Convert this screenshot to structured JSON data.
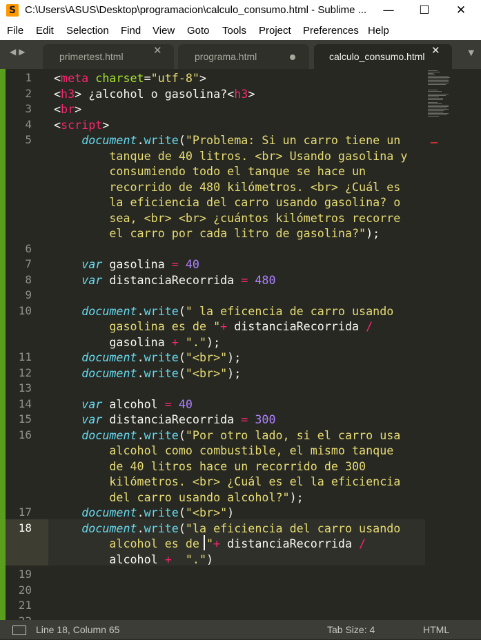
{
  "window": {
    "title": "C:\\Users\\ASUS\\Desktop\\programacion\\calculo_consumo.html - Sublime ...",
    "app_icon_glyph": "S",
    "minimize_glyph": "—",
    "maximize_glyph": "☐",
    "close_glyph": "✕"
  },
  "menu": [
    "File",
    "Edit",
    "Selection",
    "Find",
    "View",
    "Goto",
    "Tools",
    "Project",
    "Preferences",
    "Help"
  ],
  "tabs": [
    {
      "label": "primertest.html",
      "state": "close"
    },
    {
      "label": "programa.html",
      "state": "modified"
    },
    {
      "label": "calculo_consumo.html",
      "state": "close",
      "active": true
    }
  ],
  "tab_close_glyph": "✕",
  "nav_arrows": "◀▶",
  "overflow_glyph": "▼",
  "editor": {
    "line_numbers": [
      "1",
      "2",
      "3",
      "4",
      "5",
      "6",
      "7",
      "8",
      "9",
      "10",
      "11",
      "12",
      "13",
      "14",
      "15",
      "16",
      "17",
      "18",
      "19",
      "20",
      "21",
      "22"
    ],
    "current_line": "18",
    "code": [
      [
        {
          "t": "<"
        },
        {
          "c": "tag",
          "t": "meta"
        },
        {
          "t": " "
        },
        {
          "c": "attr",
          "t": "charset"
        },
        {
          "t": "="
        },
        {
          "c": "str",
          "t": "\"utf-8\""
        },
        {
          "t": ">"
        }
      ],
      [
        {
          "t": "<"
        },
        {
          "c": "tag",
          "t": "h3"
        },
        {
          "t": "> ¿alcohol o gasolina?<"
        },
        {
          "c": "tag",
          "t": "h3"
        },
        {
          "t": ">"
        }
      ],
      [
        {
          "t": "<"
        },
        {
          "c": "tag",
          "t": "br"
        },
        {
          "t": ">"
        }
      ],
      [
        {
          "t": "<"
        },
        {
          "c": "tag",
          "t": "script"
        },
        {
          "t": ">"
        }
      ],
      [
        {
          "t": "    "
        },
        {
          "c": "obj",
          "t": "document"
        },
        {
          "t": "."
        },
        {
          "c": "fn",
          "t": "write"
        },
        {
          "t": "("
        },
        {
          "c": "str",
          "t": "\"Problema: Si un carro tiene un"
        }
      ],
      [
        {
          "c": "str",
          "t": "        tanque de 40 litros. <br> Usando gasolina y"
        }
      ],
      [
        {
          "c": "str",
          "t": "        consumiendo todo el tanque se hace un"
        }
      ],
      [
        {
          "c": "str",
          "t": "        recorrido de 480 kilómetros. <br> ¿Cuál es"
        }
      ],
      [
        {
          "c": "str",
          "t": "        la eficiencia del carro usando gasolina? o"
        }
      ],
      [
        {
          "c": "str",
          "t": "        sea, <br> <br> ¿cuántos kilómetros recorre"
        }
      ],
      [
        {
          "c": "str",
          "t": "        el carro por cada litro de gasolina?\""
        },
        {
          "t": ");"
        }
      ],
      [],
      [
        {
          "t": "    "
        },
        {
          "c": "kw",
          "t": "var"
        },
        {
          "t": " gasolina "
        },
        {
          "c": "op",
          "t": "="
        },
        {
          "t": " "
        },
        {
          "c": "num",
          "t": "40"
        }
      ],
      [
        {
          "t": "    "
        },
        {
          "c": "kw",
          "t": "var"
        },
        {
          "t": " distanciaRecorrida "
        },
        {
          "c": "op",
          "t": "="
        },
        {
          "t": " "
        },
        {
          "c": "num",
          "t": "480"
        }
      ],
      [],
      [
        {
          "t": "    "
        },
        {
          "c": "obj",
          "t": "document"
        },
        {
          "t": "."
        },
        {
          "c": "fn",
          "t": "write"
        },
        {
          "t": "("
        },
        {
          "c": "str",
          "t": "\" la eficencia de carro usando"
        }
      ],
      [
        {
          "c": "str",
          "t": "        gasolina es de \""
        },
        {
          "c": "op",
          "t": "+"
        },
        {
          "t": " distanciaRecorrida "
        },
        {
          "c": "op",
          "t": "/"
        }
      ],
      [
        {
          "t": "        gasolina "
        },
        {
          "c": "op",
          "t": "+"
        },
        {
          "t": " "
        },
        {
          "c": "str",
          "t": "\".\""
        },
        {
          "t": ");"
        }
      ],
      [
        {
          "t": "    "
        },
        {
          "c": "obj",
          "t": "document"
        },
        {
          "t": "."
        },
        {
          "c": "fn",
          "t": "write"
        },
        {
          "t": "("
        },
        {
          "c": "str",
          "t": "\"<br>\""
        },
        {
          "t": ");"
        }
      ],
      [
        {
          "t": "    "
        },
        {
          "c": "obj",
          "t": "document"
        },
        {
          "t": "."
        },
        {
          "c": "fn",
          "t": "write"
        },
        {
          "t": "("
        },
        {
          "c": "str",
          "t": "\"<br>\""
        },
        {
          "t": ");"
        }
      ],
      [],
      [
        {
          "t": "    "
        },
        {
          "c": "kw",
          "t": "var"
        },
        {
          "t": " alcohol "
        },
        {
          "c": "op",
          "t": "="
        },
        {
          "t": " "
        },
        {
          "c": "num",
          "t": "40"
        }
      ],
      [
        {
          "t": "    "
        },
        {
          "c": "kw",
          "t": "var"
        },
        {
          "t": " distanciaRecorrida "
        },
        {
          "c": "op",
          "t": "="
        },
        {
          "t": " "
        },
        {
          "c": "num",
          "t": "300"
        }
      ],
      [
        {
          "t": "    "
        },
        {
          "c": "obj",
          "t": "document"
        },
        {
          "t": "."
        },
        {
          "c": "fn",
          "t": "write"
        },
        {
          "t": "("
        },
        {
          "c": "str",
          "t": "\"Por otro lado, si el carro usa"
        }
      ],
      [
        {
          "c": "str",
          "t": "        alcohol como combustible, el mismo tanque"
        }
      ],
      [
        {
          "c": "str",
          "t": "        de 40 litros hace un recorrido de 300"
        }
      ],
      [
        {
          "c": "str",
          "t": "        kilómetros. <br> ¿Cuál es el la eficiencia"
        }
      ],
      [
        {
          "c": "str",
          "t": "        del carro usando alcohol?\""
        },
        {
          "t": ");"
        }
      ],
      [
        {
          "t": "    "
        },
        {
          "c": "obj",
          "t": "document"
        },
        {
          "t": "."
        },
        {
          "c": "fn",
          "t": "write"
        },
        {
          "t": "("
        },
        {
          "c": "str",
          "t": "\"<br>\""
        },
        {
          "t": ")"
        }
      ],
      [
        {
          "t": "    "
        },
        {
          "c": "obj",
          "t": "document"
        },
        {
          "t": "."
        },
        {
          "c": "fn",
          "t": "write"
        },
        {
          "t": "("
        },
        {
          "c": "str",
          "t": "\"la eficiencia del carro usando"
        }
      ],
      [
        {
          "c": "str",
          "t": "        alcohol es de \""
        },
        {
          "c": "op",
          "t": "+"
        },
        {
          "t": " distanciaRecorrida "
        },
        {
          "c": "op",
          "t": "/"
        }
      ],
      [
        {
          "t": "        alcohol "
        },
        {
          "c": "op",
          "t": "+"
        },
        {
          "t": "  "
        },
        {
          "c": "str",
          "t": "\".\""
        },
        {
          "t": ")"
        }
      ],
      [],
      [],
      []
    ]
  },
  "status": {
    "position": "Line 18, Column 65",
    "tab_size": "Tab Size: 4",
    "syntax": "HTML"
  },
  "colors": {
    "background": "#272822",
    "tag": "#f92672",
    "attr": "#a6e22e",
    "string": "#e6db74",
    "keyword": "#66d9ef",
    "number": "#ae81ff"
  }
}
